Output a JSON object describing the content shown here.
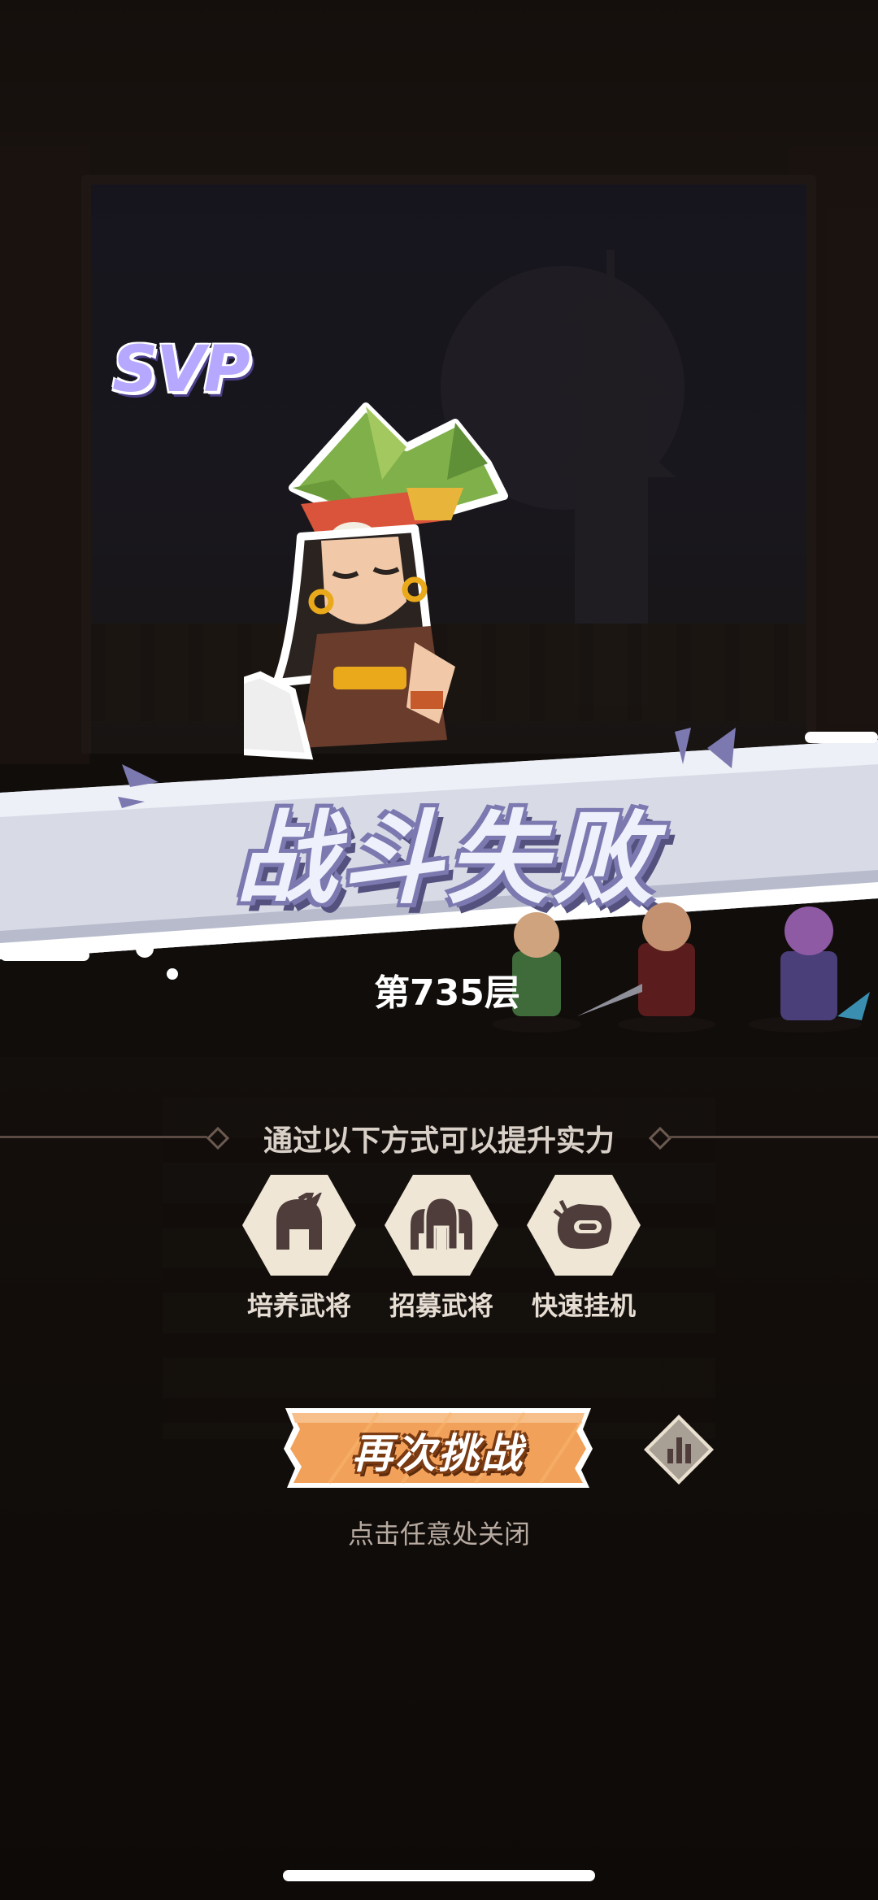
{
  "background": {
    "accent": "#f0a050",
    "banner_color": "#d8dbe6"
  },
  "badge": {
    "svp": "SVP"
  },
  "result": {
    "title": "战斗失败",
    "floor": "第735层"
  },
  "tips": {
    "title": "通过以下方式可以提升实力",
    "options": [
      {
        "label": "培养武将",
        "icon": "general-helmet-icon"
      },
      {
        "label": "招募武将",
        "icon": "recruit-generals-icon"
      },
      {
        "label": "快速挂机",
        "icon": "quick-idle-icon"
      }
    ]
  },
  "actions": {
    "retry_label": "再次挑战",
    "stats_icon": "bar-chart-icon",
    "close_hint": "点击任意处关闭"
  }
}
